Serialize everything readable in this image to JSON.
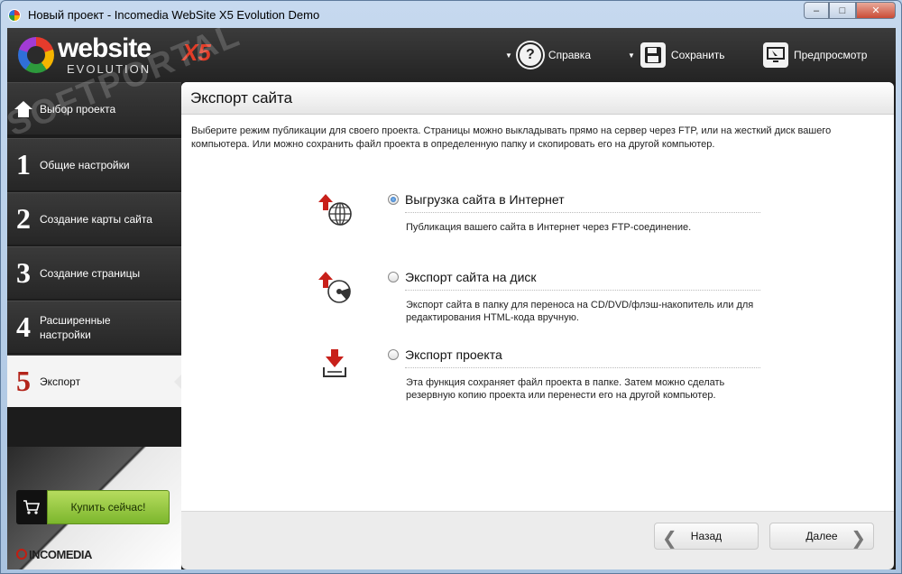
{
  "window": {
    "title": "Новый проект - Incomedia WebSite X5 Evolution Demo",
    "minimize": "–",
    "maximize": "□",
    "close": "✕"
  },
  "logo": {
    "word": "website",
    "x5": "X5",
    "edition": "EVOLUTION"
  },
  "watermark": "SOFTPORTAL",
  "toolbar": {
    "help_label": "Справка",
    "save_label": "Сохранить",
    "preview_label": "Предпросмотр"
  },
  "sidebar": {
    "items": [
      {
        "num": "",
        "label": "Выбор проекта"
      },
      {
        "num": "1",
        "label": "Общие настройки"
      },
      {
        "num": "2",
        "label": "Создание карты сайта"
      },
      {
        "num": "3",
        "label": "Создание страницы"
      },
      {
        "num": "4",
        "label": "Расширенные настройки"
      },
      {
        "num": "5",
        "label": "Экспорт"
      }
    ],
    "buy_label": "Купить сейчас!",
    "brand": "INCOMEDIA"
  },
  "main": {
    "title": "Экспорт сайта",
    "description": "Выберите режим публикации для своего проекта. Страницы можно выкладывать прямо на сервер через FTP, или на жесткий диск вашего компьютера. Или можно сохранить файл проекта в определенную папку и скопировать его на другой компьютер.",
    "options": [
      {
        "title": "Выгрузка сайта в Интернет",
        "desc": "Публикация вашего сайта в Интернет через FTP-соединение.",
        "checked": true
      },
      {
        "title": "Экспорт сайта на диск",
        "desc": "Экспорт сайта в папку для переноса на CD/DVD/флэш-накопитель или для редактирования HTML-кода вручную.",
        "checked": false
      },
      {
        "title": "Экспорт проекта",
        "desc": "Эта функция сохраняет файл проекта в папке. Затем можно сделать резервную копию проекта или перенести его на другой компьютер.",
        "checked": false
      }
    ],
    "back_label": "Назад",
    "next_label": "Далее"
  },
  "colors": {
    "accent_red": "#b3241a",
    "buy_green": "#8cc63f",
    "dark_bg": "#262626"
  }
}
